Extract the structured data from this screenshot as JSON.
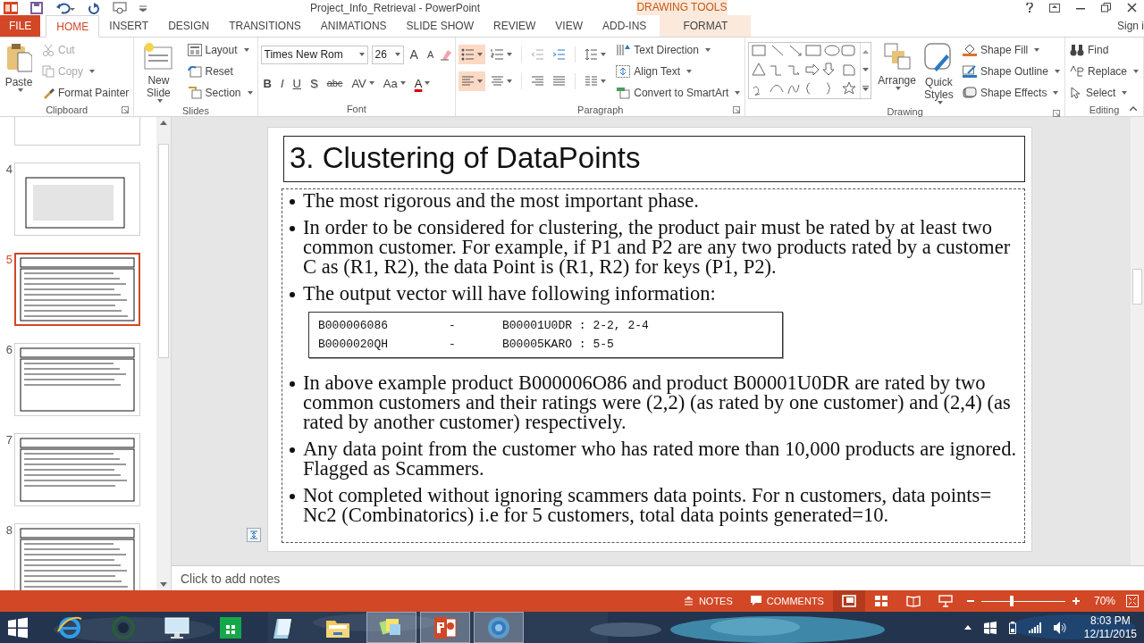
{
  "window": {
    "title": "Project_Info_Retrieval - PowerPoint",
    "contextual_label": "DRAWING TOOLS",
    "sign_in": "Sign i"
  },
  "tabs": [
    {
      "label": "FILE",
      "kind": "file",
      "selected": false
    },
    {
      "label": "HOME",
      "kind": "tab",
      "selected": true
    },
    {
      "label": "INSERT",
      "kind": "tab",
      "selected": false
    },
    {
      "label": "DESIGN",
      "kind": "tab",
      "selected": false
    },
    {
      "label": "TRANSITIONS",
      "kind": "tab",
      "selected": false
    },
    {
      "label": "ANIMATIONS",
      "kind": "tab",
      "selected": false
    },
    {
      "label": "SLIDE SHOW",
      "kind": "tab",
      "selected": false
    },
    {
      "label": "REVIEW",
      "kind": "tab",
      "selected": false
    },
    {
      "label": "VIEW",
      "kind": "tab",
      "selected": false
    },
    {
      "label": "ADD-INS",
      "kind": "tab",
      "selected": false
    },
    {
      "label": "FORMAT",
      "kind": "contextual",
      "selected": false
    }
  ],
  "ribbon": {
    "groups": [
      {
        "label": "Clipboard",
        "launcher": true,
        "columns": [
          [
            {
              "kind": "large",
              "label": "Paste",
              "dropdown": true,
              "disabled": false
            }
          ],
          [
            {
              "kind": "small",
              "label": "Cut",
              "dropdown": false,
              "disabled": true
            },
            {
              "kind": "small",
              "label": "Copy",
              "dropdown": true,
              "disabled": true
            },
            {
              "kind": "small",
              "label": "Format Painter",
              "dropdown": false,
              "disabled": false
            }
          ]
        ]
      },
      {
        "label": "Slides",
        "launcher": false,
        "columns": [
          [
            {
              "kind": "large",
              "label": "New Slide",
              "dropdown": true,
              "disabled": false
            }
          ],
          [
            {
              "kind": "small",
              "label": "Layout",
              "dropdown": true,
              "disabled": false
            },
            {
              "kind": "small",
              "label": "Reset",
              "dropdown": false,
              "disabled": false
            },
            {
              "kind": "small",
              "label": "Section",
              "dropdown": true,
              "disabled": false
            }
          ]
        ]
      },
      {
        "label": "Font",
        "launcher": false,
        "columns": [
          [
            {
              "kind": "font_fields",
              "font": "Times New Rom",
              "size": "26",
              "size_buttons": [
                "A",
                "A"
              ]
            },
            {
              "kind": "format_row",
              "buttons": [
                {
                  "label": "B",
                  "dropdown": false
                },
                {
                  "label": "I",
                  "dropdown": false
                },
                {
                  "label": "U",
                  "dropdown": false
                },
                {
                  "label": "S",
                  "dropdown": false
                },
                {
                  "label": "abc",
                  "dropdown": false
                },
                {
                  "label": "AV",
                  "dropdown": true
                },
                {
                  "label": "Aa",
                  "dropdown": true
                },
                {
                  "label": "A",
                  "dropdown": true
                }
              ]
            }
          ]
        ]
      },
      {
        "label": "Paragraph",
        "launcher": true,
        "columns": [
          [
            {
              "kind": "toggle_row",
              "toggles": [
                {
                  "kind": "bullets",
                  "selected": true
                },
                {
                  "kind": "numbering",
                  "selected": false
                },
                {
                  "kind": "outdent",
                  "selected": false
                },
                {
                  "kind": "indent",
                  "selected": false
                },
                {
                  "kind": "spacing",
                  "selected": false
                }
              ]
            },
            {
              "kind": "toggle_row",
              "toggles": [
                {
                  "kind": "left",
                  "selected": true
                },
                {
                  "kind": "center",
                  "selected": false
                },
                {
                  "kind": "right",
                  "selected": false
                },
                {
                  "kind": "justify",
                  "selected": false
                },
                {
                  "kind": "columns",
                  "selected": false
                }
              ]
            }
          ],
          [
            {
              "kind": "small",
              "label": "Text Direction",
              "dropdown": true,
              "disabled": false
            },
            {
              "kind": "small",
              "label": "Align Text",
              "dropdown": true,
              "disabled": false
            },
            {
              "kind": "small",
              "label": "Convert to SmartArt",
              "dropdown": true,
              "disabled": false
            }
          ]
        ]
      },
      {
        "label": "Drawing",
        "launcher": true,
        "columns": [
          [
            {
              "kind": "shape_gallery"
            }
          ],
          [
            {
              "kind": "large",
              "label": "Arrange",
              "dropdown": true,
              "disabled": false
            }
          ],
          [
            {
              "kind": "large",
              "label": "Quick Styles",
              "dropdown": true,
              "disabled": false
            }
          ],
          [
            {
              "kind": "small",
              "label": "Shape Fill",
              "dropdown": true,
              "disabled": false
            },
            {
              "kind": "small",
              "label": "Shape Outline",
              "dropdown": true,
              "disabled": false
            },
            {
              "kind": "small",
              "label": "Shape Effects",
              "dropdown": true,
              "disabled": false
            }
          ]
        ]
      },
      {
        "label": "Editing",
        "launcher": false,
        "columns": [
          [
            {
              "kind": "small",
              "label": "Find",
              "dropdown": false,
              "disabled": false
            },
            {
              "kind": "small",
              "label": "Replace",
              "dropdown": true,
              "disabled": false
            },
            {
              "kind": "small",
              "label": "Select",
              "dropdown": true,
              "disabled": false
            }
          ]
        ]
      }
    ]
  },
  "slide_panel": {
    "thumbnails": [
      {
        "selected": false
      },
      {
        "number": "4",
        "selected": false
      },
      {
        "number": "5",
        "selected": true
      },
      {
        "number": "6",
        "selected": false
      },
      {
        "number": "7",
        "selected": false
      },
      {
        "number": "8",
        "selected": false
      }
    ]
  },
  "slide": {
    "title": "3. Clustering of DataPoints",
    "body": [
      {
        "kind": "bullet",
        "text": "The most rigorous and the most important phase."
      },
      {
        "kind": "bullet",
        "text": "In order to be considered for clustering, the product pair must be rated by at least two common customer. For example, if P1 and P2 are any two products rated by a customer C as (R1, R2), the data Point is (R1, R2) for keys (P1, P2)."
      },
      {
        "kind": "bullet",
        "text": "The output vector will have following information:"
      },
      {
        "kind": "code_table",
        "rows": [
          [
            "B000006086",
            "-",
            "B00001U0DR : 2-2, 2-4"
          ],
          [
            "B0000020QH",
            "-",
            "B00005KARO : 5-5"
          ]
        ]
      },
      {
        "kind": "bullet",
        "text": "In above example product  B000006O86  and product B00001U0DR are rated by two common customers and their ratings were (2,2) (as rated by one customer) and (2,4) (as rated by another customer) respectively."
      },
      {
        "kind": "bullet",
        "text": "Any data point from the customer who has rated more than 10,000 products are ignored. Flagged as Scammers."
      },
      {
        "kind": "bullet",
        "text": "Not completed without ignoring scammers data points. For n customers, data points= Nc2 (Combinatorics) i.e for 5 customers, total data points generated=10."
      }
    ]
  },
  "notes": {
    "placeholder": "Click to add notes"
  },
  "status_bar": {
    "notes": "NOTES",
    "comments": "COMMENTS",
    "views": [
      {
        "kind": "normal",
        "selected": true
      },
      {
        "kind": "sorter",
        "selected": false
      },
      {
        "kind": "reading",
        "selected": false
      },
      {
        "kind": "show",
        "selected": false
      }
    ],
    "zoom": {
      "level": 0.36,
      "reading": "70%"
    }
  },
  "taskbar": {
    "apps": [
      {
        "kind": "browser",
        "open": false
      },
      {
        "kind": "ring",
        "open": false
      },
      {
        "kind": "monitor",
        "open": false
      },
      {
        "kind": "store",
        "open": false
      },
      {
        "kind": "notepad",
        "open": false
      },
      {
        "kind": "folder",
        "open": false
      },
      {
        "kind": "notes",
        "open": true
      },
      {
        "kind": "powerpoint",
        "open": true
      },
      {
        "kind": "disc",
        "open": true
      }
    ],
    "clock": {
      "time": "8:03 PM",
      "date": "12/11/2015"
    }
  }
}
